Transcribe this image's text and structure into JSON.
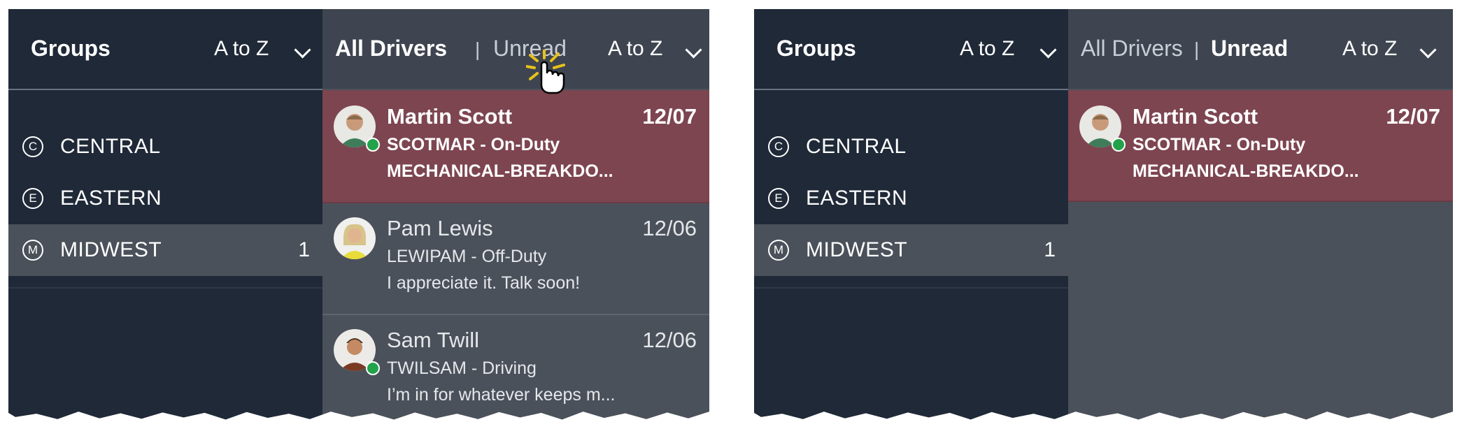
{
  "colors": {
    "panel_dark": "#1f2937",
    "panel_gray": "#4b515a",
    "unread_row": "#7d4550",
    "online_dot": "#22a24a"
  },
  "left": {
    "groups": {
      "title": "Groups",
      "sort_label": "A to Z",
      "items": [
        {
          "letter": "C",
          "label": "CENTRAL",
          "count": ""
        },
        {
          "letter": "E",
          "label": "EASTERN",
          "count": ""
        },
        {
          "letter": "M",
          "label": "MIDWEST",
          "count": "1"
        }
      ]
    },
    "drivers": {
      "tab_all": "All Drivers",
      "separator": "|",
      "tab_unread": "Unread",
      "active_tab": "All Drivers",
      "sort_label": "A to Z",
      "rows": [
        {
          "name": "Martin Scott",
          "date": "12/07",
          "status": "SCOTMAR - On-Duty",
          "message": "MECHANICAL-BREAKDO...",
          "unread": true,
          "online": true
        },
        {
          "name": "Pam Lewis",
          "date": "12/06",
          "status": "LEWIPAM - Off-Duty",
          "message": "I appreciate it. Talk soon!",
          "unread": false,
          "online": false
        },
        {
          "name": "Sam Twill",
          "date": "12/06",
          "status": "TWILSAM - Driving",
          "message": "I’m in for whatever keeps m...",
          "unread": false,
          "online": true
        }
      ]
    }
  },
  "right": {
    "groups": {
      "title": "Groups",
      "sort_label": "A to Z",
      "items": [
        {
          "letter": "C",
          "label": "CENTRAL",
          "count": ""
        },
        {
          "letter": "E",
          "label": "EASTERN",
          "count": ""
        },
        {
          "letter": "M",
          "label": "MIDWEST",
          "count": "1"
        }
      ]
    },
    "drivers": {
      "tab_all": "All Drivers",
      "separator": "|",
      "tab_unread": "Unread",
      "active_tab": "Unread",
      "sort_label": "A to Z",
      "rows": [
        {
          "name": "Martin Scott",
          "date": "12/07",
          "status": "SCOTMAR - On-Duty",
          "message": "MECHANICAL-BREAKDO...",
          "unread": true,
          "online": true
        }
      ]
    }
  }
}
